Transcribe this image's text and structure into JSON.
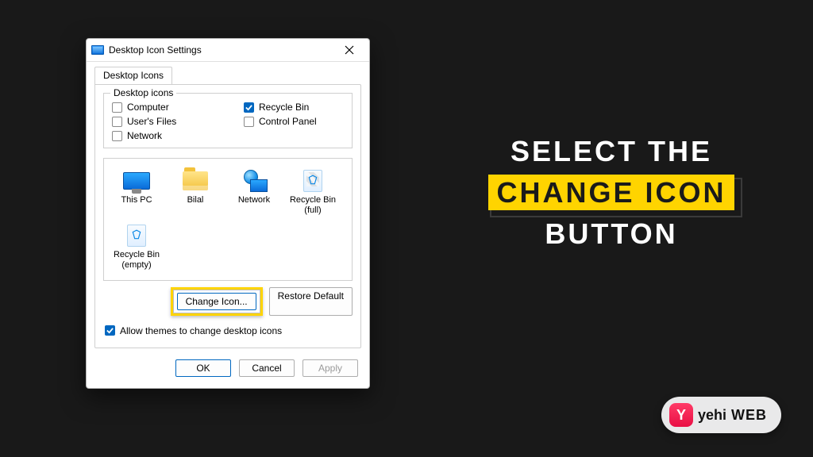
{
  "dialog": {
    "title": "Desktop Icon Settings",
    "tab": "Desktop Icons",
    "groupbox_legend": "Desktop icons",
    "checkboxes": {
      "computer": {
        "label": "Computer",
        "checked": false
      },
      "users_files": {
        "label": "User's Files",
        "checked": false
      },
      "network": {
        "label": "Network",
        "checked": false
      },
      "recycle_bin": {
        "label": "Recycle Bin",
        "checked": true
      },
      "control_panel": {
        "label": "Control Panel",
        "checked": false
      }
    },
    "icons": [
      {
        "label": "This PC"
      },
      {
        "label": "Bilal"
      },
      {
        "label": "Network"
      },
      {
        "label": "Recycle Bin (full)"
      },
      {
        "label": "Recycle Bin (empty)"
      }
    ],
    "buttons": {
      "change_icon": "Change Icon...",
      "restore_default": "Restore Default",
      "ok": "OK",
      "cancel": "Cancel",
      "apply": "Apply"
    },
    "allow_themes": {
      "label": "Allow themes to change desktop icons",
      "checked": true
    }
  },
  "instruction": {
    "line1": "SELECT THE",
    "line2": "CHANGE ICON",
    "line3": "BUTTON"
  },
  "watermark": {
    "logo_letter": "Y",
    "text1": "yehi",
    "text2": "WEB"
  }
}
